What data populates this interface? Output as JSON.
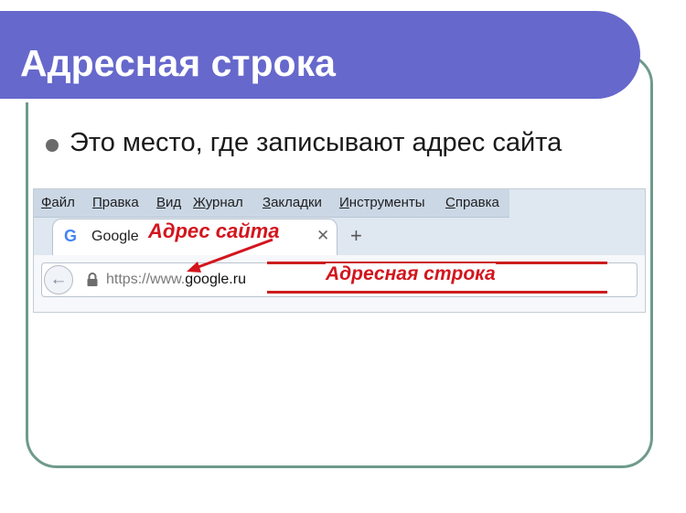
{
  "slide": {
    "title": "Адресная строка",
    "bullet": "Это место, где записывают адрес сайта"
  },
  "browser": {
    "menu": [
      {
        "pre": "",
        "u": "Ф",
        "post": "айл"
      },
      {
        "pre": "",
        "u": "П",
        "post": "равка"
      },
      {
        "pre": "",
        "u": "В",
        "post": "ид"
      },
      {
        "pre": "",
        "u": "Ж",
        "post": "урнал"
      },
      {
        "pre": "",
        "u": "З",
        "post": "акладки"
      },
      {
        "pre": "",
        "u": "И",
        "post": "нструменты"
      },
      {
        "pre": "",
        "u": "С",
        "post": "правка"
      }
    ],
    "tab": {
      "title": "Google",
      "close_icon": "close-icon",
      "favicon": "google-icon"
    },
    "new_tab_symbol": "+",
    "back_icon": "back-arrow-icon",
    "lock_icon": "lock-icon",
    "url": {
      "scheme": "https://www.",
      "host": "google.ru"
    }
  },
  "annotations": {
    "site_address": "Адрес сайта",
    "address_bar": "Адресная строка",
    "color": "#d3151d"
  },
  "colors": {
    "title_bar": "#6668cc",
    "frame": "#6f9a8c"
  }
}
